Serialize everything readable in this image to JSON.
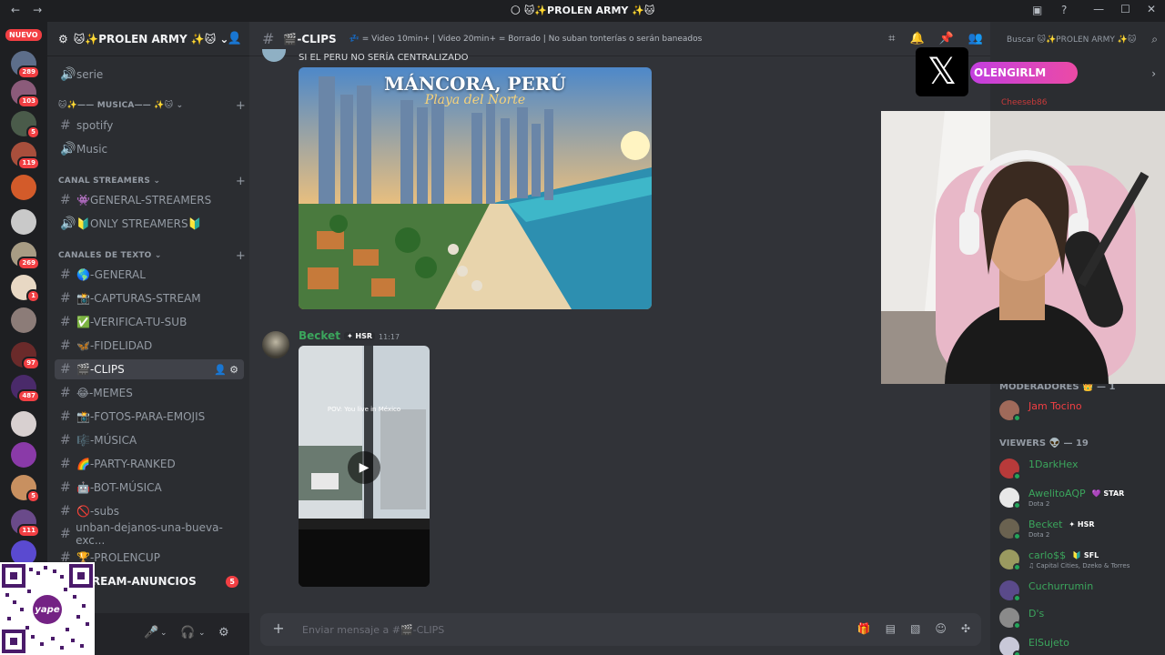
{
  "window": {
    "title": "🌕 🐱✨PROLEN ARMY ✨🐱",
    "controls": [
      "—",
      "☐",
      "✕"
    ]
  },
  "guilds": {
    "nuevo_label": "NUEVO",
    "badges": [
      "289",
      "103",
      "5",
      "119",
      "269",
      "1",
      "97",
      "487",
      "5",
      "111"
    ]
  },
  "server": {
    "name": "🐱✨PROLEN ARMY ✨🐱"
  },
  "channels": {
    "serie": "serie",
    "cat_musica": "🐱✨—— MUSICA—— ✨🐱",
    "spotify": "spotify",
    "music": "Music",
    "cat_streamers": "CANAL STREAMERS",
    "general_streamers": "👾GENERAL-STREAMERS",
    "only_streamers": "🔰ONLY STREAMERS🔰",
    "cat_texto": "CANALES DE TEXTO",
    "general": "🌎-GENERAL",
    "capturas": "📸-CAPTURAS-STREAM",
    "verifica": "✅-VERIFICA-TU-SUB",
    "fidelidad": "🦋-FIDELIDAD",
    "clips": "🎬-CLIPS",
    "memes": "😂-MEMES",
    "fotos": "📸-FOTOS-PARA-EMOJIS",
    "musica": "🎼-MÚSICA",
    "party": "🌈-PARTY-RANKED",
    "bot": "🤖-BOT-MÚSICA",
    "subs": "🚫-subs",
    "unban": "unban-dejanos-una-bueva-exc...",
    "prolencup": "🏆-PROLENCUP",
    "anuncios": "STREAM-ANUNCIOS",
    "anuncios_badge": "5"
  },
  "qr": {
    "brand": "yape"
  },
  "topbar": {
    "channel_name": "🎬-CLIPS",
    "topic": "💤 = Video 10min+ | Video 20min+ = Borrado | No suban tonterías o serán baneados"
  },
  "messages": {
    "prev_text": "SI EL PERU NO SERÍA CENTRALIZADO",
    "image_title": "MÁNCORA, PERÚ",
    "image_subtitle": "Playa del Norte",
    "author": "Becket",
    "author_tag": "✦ HSR",
    "time": "11:17",
    "video_caption": "POV: You live in México"
  },
  "composer": {
    "placeholder": "Enviar mensaje a #🎬-CLIPS"
  },
  "overlay": {
    "x_logo": "𝕏",
    "handle": "OLENGIRLM"
  },
  "members": {
    "search_placeholder": "Buscar 🐱✨PROLEN ARMY ✨🐱",
    "partial_name": "Cheeseb86",
    "cat_mods": "MODERADORES 👑 — 1",
    "mod1": "Jam Tocino",
    "cat_viewers": "VIEWERS 👽 — 19",
    "list": [
      {
        "name": "1DarkHex",
        "sub": "",
        "tag": "",
        "color": "#3ba55c"
      },
      {
        "name": "AwelitoAQP",
        "sub": "Dota 2",
        "tag": "💜 STAR",
        "color": "#3ba55c"
      },
      {
        "name": "Becket",
        "sub": "Dota 2",
        "tag": "✦ HSR",
        "color": "#3ba55c"
      },
      {
        "name": "carlo$$",
        "sub": "♫ Capital Cities, Dzeko & Torres",
        "tag": "🔰 SFL",
        "color": "#3ba55c"
      },
      {
        "name": "Cuchurrumin",
        "sub": "",
        "tag": "",
        "color": "#3ba55c"
      },
      {
        "name": "D's",
        "sub": "",
        "tag": "",
        "color": "#3ba55c"
      },
      {
        "name": "ElSujeto",
        "sub": "",
        "tag": "",
        "color": "#3ba55c"
      }
    ]
  },
  "colors": {
    "accent": "#5865f2",
    "online": "#23a55a",
    "mod_red": "#f23f43",
    "viewer_green": "#3ba55c"
  }
}
